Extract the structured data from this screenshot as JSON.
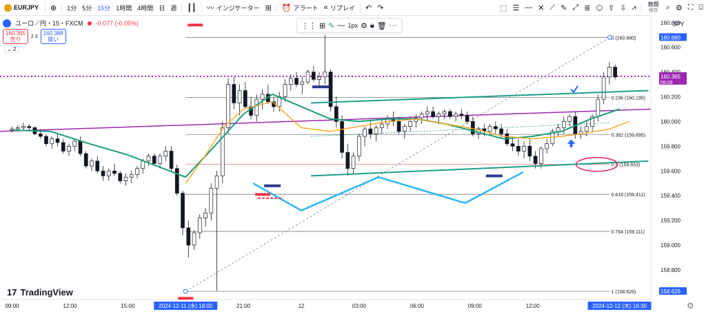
{
  "toolbar": {
    "symbol": "EURJPY",
    "add_icon": "plus-circle-icon",
    "intervals": [
      "1分",
      "5分",
      "15分",
      "1時間",
      "4時間",
      "日",
      "週"
    ],
    "selected_interval": "15分",
    "indicators_label": "インジケーター",
    "alert_label": "アラート",
    "replay_label": "リプレイ",
    "layout_label": "無題",
    "layout_sub": "保存"
  },
  "legend": {
    "title": "ユーロ／円・15・FXCM",
    "change": "-0.077 (-0.05%)"
  },
  "price_buttons": {
    "sell_price": "160.365",
    "sell_label": "売り",
    "spread": "2.3",
    "buy_price": "160.388",
    "buy_label": "買い"
  },
  "indicator_toggle": "2",
  "drawbar": {
    "width_label": "1px"
  },
  "currency": "JPY",
  "watermark": "TradingView",
  "colors": {
    "up": "#ffffff",
    "down": "#131722",
    "ema_teal": "#1b9e77",
    "ema_orange": "#f5a623",
    "channel": "#1e9e8a",
    "purple": "#9c27b0",
    "fib": "#131722",
    "blue_zigzag": "#29b6f6",
    "mark_red": "#f23645",
    "mark_navy": "#2e3b8c",
    "axis_blue": "#2962ff",
    "axis_purple": "#9c27b0"
  },
  "chart_data": {
    "type": "candlestick",
    "title": "",
    "xlabel": "",
    "ylabel": "",
    "ylim": [
      158.56,
      160.86
    ],
    "y_ticks": [
      160.8,
      160.6,
      160.4,
      160.2,
      160.0,
      159.8,
      159.6,
      159.4,
      159.2,
      159.0,
      158.8
    ],
    "x_ticks": [
      {
        "t": 0.0,
        "label": "09:00"
      },
      {
        "t": 12.0,
        "label": "12:00"
      },
      {
        "t": 24.0,
        "label": "15:00"
      },
      {
        "t": 48.0,
        "label": "21:00"
      },
      {
        "t": 60.0,
        "label": "12"
      },
      {
        "t": 72.0,
        "label": "03:00"
      },
      {
        "t": 84.0,
        "label": "06:00"
      },
      {
        "t": 96.0,
        "label": "09:00"
      },
      {
        "t": 108.0,
        "label": "12:00"
      },
      {
        "t": 120.0,
        "label": "15"
      },
      {
        "t": 132.0,
        "label": "00"
      }
    ],
    "x_range": [
      -2.5,
      132.5
    ],
    "time_badges": [
      {
        "t": 36.0,
        "label": "2024-12-11 (水)   18:00"
      },
      {
        "t": 126.0,
        "label": "2024-12-12 (木)   16:30"
      }
    ],
    "price_badges": [
      {
        "value": 160.68,
        "label": "160.680",
        "color": "#2962ff"
      },
      {
        "value": 160.365,
        "label": "160.365",
        "sub": "08:09",
        "color": "#9c27b0"
      },
      {
        "value": 158.626,
        "label": "158.626",
        "color": "#2962ff"
      }
    ],
    "fibonacci": [
      {
        "level": "0",
        "value": 160.68
      },
      {
        "level": "0.236",
        "value": 160.195
      },
      {
        "level": "0.382",
        "value": 159.895
      },
      {
        "level": "0.5",
        "value": 159.653
      },
      {
        "level": "0.618",
        "value": 159.411
      },
      {
        "level": "0.764",
        "value": 159.111
      },
      {
        "level": "1",
        "value": 158.626
      }
    ],
    "fib_time_range": [
      36,
      124
    ],
    "horizontal_line": {
      "value": 160.365
    },
    "ohlc": [
      [
        159.93,
        159.96,
        159.91,
        159.94
      ],
      [
        159.94,
        159.97,
        159.92,
        159.95
      ],
      [
        159.95,
        159.99,
        159.93,
        159.96
      ],
      [
        159.96,
        159.98,
        159.93,
        159.95
      ],
      [
        159.95,
        159.96,
        159.89,
        159.9
      ],
      [
        159.9,
        159.94,
        159.86,
        159.88
      ],
      [
        159.88,
        159.9,
        159.8,
        159.82
      ],
      [
        159.82,
        159.88,
        159.78,
        159.86
      ],
      [
        159.86,
        159.9,
        159.8,
        159.83
      ],
      [
        159.83,
        159.86,
        159.74,
        159.76
      ],
      [
        159.76,
        159.82,
        159.72,
        159.8
      ],
      [
        159.8,
        159.86,
        159.76,
        159.84
      ],
      [
        159.84,
        159.88,
        159.72,
        159.74
      ],
      [
        159.74,
        159.76,
        159.62,
        159.64
      ],
      [
        159.64,
        159.7,
        159.6,
        159.68
      ],
      [
        159.68,
        159.72,
        159.58,
        159.6
      ],
      [
        159.6,
        159.64,
        159.52,
        159.56
      ],
      [
        159.56,
        159.62,
        159.52,
        159.6
      ],
      [
        159.6,
        159.66,
        159.56,
        159.58
      ],
      [
        159.58,
        159.6,
        159.5,
        159.52
      ],
      [
        159.52,
        159.58,
        159.48,
        159.55
      ],
      [
        159.55,
        159.6,
        159.5,
        159.57
      ],
      [
        159.57,
        159.64,
        159.54,
        159.62
      ],
      [
        159.62,
        159.7,
        159.58,
        159.68
      ],
      [
        159.68,
        159.74,
        159.64,
        159.72
      ],
      [
        159.72,
        159.74,
        159.64,
        159.66
      ],
      [
        159.66,
        159.74,
        159.62,
        159.72
      ],
      [
        159.72,
        159.8,
        159.68,
        159.76
      ],
      [
        159.76,
        159.8,
        159.6,
        159.62
      ],
      [
        159.62,
        159.65,
        159.4,
        159.42
      ],
      [
        159.42,
        159.44,
        159.08,
        159.14
      ],
      [
        159.14,
        159.2,
        158.9,
        159.0
      ],
      [
        159.0,
        159.12,
        158.96,
        159.1
      ],
      [
        159.1,
        159.25,
        159.05,
        159.22
      ],
      [
        159.22,
        159.3,
        159.15,
        159.26
      ],
      [
        159.26,
        159.5,
        159.2,
        159.46
      ],
      [
        159.46,
        159.6,
        158.63,
        159.56
      ],
      [
        159.56,
        160.0,
        159.5,
        159.95
      ],
      [
        159.95,
        160.35,
        159.9,
        160.3
      ],
      [
        160.3,
        160.36,
        160.1,
        160.15
      ],
      [
        160.15,
        160.3,
        160.05,
        160.25
      ],
      [
        160.25,
        160.32,
        160.1,
        160.12
      ],
      [
        160.12,
        160.2,
        160.02,
        160.05
      ],
      [
        160.05,
        160.22,
        160.0,
        160.18
      ],
      [
        160.18,
        160.26,
        160.1,
        160.22
      ],
      [
        160.22,
        160.3,
        160.14,
        160.16
      ],
      [
        160.16,
        160.2,
        160.08,
        160.12
      ],
      [
        160.12,
        160.24,
        160.08,
        160.2
      ],
      [
        160.2,
        160.34,
        160.16,
        160.3
      ],
      [
        160.3,
        160.38,
        160.25,
        160.35
      ],
      [
        160.35,
        160.4,
        160.28,
        160.3
      ],
      [
        160.3,
        160.36,
        160.22,
        160.32
      ],
      [
        160.32,
        160.42,
        160.3,
        160.4
      ],
      [
        160.4,
        160.45,
        160.32,
        160.34
      ],
      [
        160.34,
        160.4,
        160.28,
        160.36
      ],
      [
        160.36,
        160.7,
        160.3,
        160.4
      ],
      [
        160.4,
        160.42,
        160.08,
        160.12
      ],
      [
        160.12,
        160.2,
        159.95,
        160.0
      ],
      [
        160.0,
        160.05,
        159.7,
        159.75
      ],
      [
        159.75,
        159.82,
        159.56,
        159.62
      ],
      [
        159.62,
        159.75,
        159.58,
        159.72
      ],
      [
        159.72,
        159.9,
        159.68,
        159.88
      ],
      [
        159.88,
        159.96,
        159.8,
        159.94
      ],
      [
        159.94,
        160.0,
        159.86,
        159.9
      ],
      [
        159.9,
        159.97,
        159.84,
        159.95
      ],
      [
        159.95,
        160.02,
        159.9,
        159.98
      ],
      [
        159.98,
        160.05,
        159.94,
        160.02
      ],
      [
        160.02,
        160.08,
        159.96,
        160.0
      ],
      [
        160.0,
        160.04,
        159.9,
        159.92
      ],
      [
        159.92,
        159.98,
        159.86,
        159.96
      ],
      [
        159.96,
        160.04,
        159.92,
        160.0
      ],
      [
        160.0,
        160.06,
        159.95,
        160.03
      ],
      [
        160.03,
        160.08,
        159.98,
        160.06
      ],
      [
        160.06,
        160.12,
        160.0,
        160.08
      ],
      [
        160.08,
        160.12,
        160.02,
        160.04
      ],
      [
        160.04,
        160.08,
        159.98,
        160.06
      ],
      [
        160.06,
        160.1,
        160.02,
        160.08
      ],
      [
        160.08,
        160.1,
        160.02,
        160.04
      ],
      [
        160.04,
        160.08,
        160.0,
        160.06
      ],
      [
        160.06,
        160.1,
        160.02,
        160.05
      ],
      [
        160.05,
        160.08,
        159.98,
        160.0
      ],
      [
        160.0,
        160.04,
        159.88,
        159.9
      ],
      [
        159.9,
        159.96,
        159.86,
        159.94
      ],
      [
        159.94,
        159.98,
        159.88,
        159.92
      ],
      [
        159.92,
        159.98,
        159.88,
        159.96
      ],
      [
        159.96,
        160.0,
        159.9,
        159.94
      ],
      [
        159.94,
        159.98,
        159.86,
        159.9
      ],
      [
        159.9,
        159.94,
        159.8,
        159.82
      ],
      [
        159.82,
        159.88,
        159.76,
        159.8
      ],
      [
        159.8,
        159.86,
        159.72,
        159.76
      ],
      [
        159.76,
        159.84,
        159.7,
        159.8
      ],
      [
        159.8,
        159.86,
        159.68,
        159.72
      ],
      [
        159.72,
        159.76,
        159.62,
        159.66
      ],
      [
        159.66,
        159.8,
        159.62,
        159.78
      ],
      [
        159.78,
        159.86,
        159.74,
        159.82
      ],
      [
        159.82,
        159.94,
        159.8,
        159.92
      ],
      [
        159.92,
        159.98,
        159.88,
        159.95
      ],
      [
        159.95,
        160.04,
        159.9,
        160.0
      ],
      [
        160.0,
        160.06,
        159.96,
        160.04
      ],
      [
        160.04,
        160.08,
        159.86,
        159.9
      ],
      [
        159.9,
        159.96,
        159.86,
        159.92
      ],
      [
        159.92,
        160.0,
        159.88,
        159.96
      ],
      [
        159.96,
        160.06,
        159.92,
        160.04
      ],
      [
        160.04,
        160.22,
        160.0,
        160.18
      ],
      [
        160.18,
        160.4,
        160.14,
        160.36
      ],
      [
        160.36,
        160.48,
        160.3,
        160.44
      ],
      [
        160.44,
        160.46,
        160.34,
        160.36
      ]
    ],
    "ohlc_start_t": 0,
    "ohlc_step_t": 1.18,
    "series": [
      {
        "name": "",
        "color": "#1b9e77",
        "points": [
          [
            0,
            159.93
          ],
          [
            8,
            159.92
          ],
          [
            16,
            159.82
          ],
          [
            24,
            159.73
          ],
          [
            30,
            159.64
          ],
          [
            36,
            159.55
          ],
          [
            42,
            159.8
          ],
          [
            48,
            160.06
          ],
          [
            54,
            160.22
          ],
          [
            60,
            160.12
          ],
          [
            66,
            160.02
          ],
          [
            72,
            160.0
          ],
          [
            78,
            160.02
          ],
          [
            84,
            160.02
          ],
          [
            90,
            159.98
          ],
          [
            96,
            159.92
          ],
          [
            102,
            159.86
          ],
          [
            108,
            159.88
          ],
          [
            114,
            159.92
          ],
          [
            120,
            160.02
          ],
          [
            126,
            160.1
          ]
        ]
      },
      {
        "name": "",
        "color": "#f5a623",
        "points": [
          [
            36,
            159.5
          ],
          [
            40,
            159.72
          ],
          [
            44,
            159.96
          ],
          [
            48,
            160.1
          ],
          [
            54,
            160.16
          ],
          [
            60,
            159.95
          ],
          [
            66,
            159.92
          ],
          [
            72,
            159.96
          ],
          [
            78,
            160.0
          ],
          [
            84,
            160.02
          ],
          [
            90,
            159.98
          ],
          [
            96,
            159.94
          ],
          [
            102,
            159.88
          ],
          [
            108,
            159.86
          ],
          [
            114,
            159.88
          ],
          [
            118,
            159.9
          ],
          [
            124,
            159.94
          ],
          [
            128,
            160.0
          ]
        ]
      }
    ],
    "channel_lines": [
      {
        "from": [
          62,
          160.15
        ],
        "to": [
          132,
          160.25
        ]
      },
      {
        "from": [
          62,
          159.56
        ],
        "to": [
          132,
          159.68
        ]
      }
    ],
    "purple_line": {
      "from": [
        -2.5,
        159.92
      ],
      "to": [
        132.5,
        160.1
      ]
    },
    "zigzag": [
      [
        50,
        159.5
      ],
      [
        60,
        159.28
      ],
      [
        76,
        159.55
      ],
      [
        94,
        159.34
      ],
      [
        106,
        159.59
      ]
    ],
    "diagonal": {
      "from": [
        36,
        158.626
      ],
      "to": [
        124,
        160.68
      ]
    },
    "circle_annotation": {
      "t": 117,
      "value": 159.653
    },
    "check_mark": {
      "t": 116.5,
      "value": 160.26
    },
    "arrow_up": {
      "t": 116,
      "value": 159.82
    },
    "markers_red": [
      [
        38,
        160.78
      ],
      [
        36,
        158.57
      ],
      [
        52,
        159.41
      ]
    ],
    "markers_navy": [
      [
        64,
        160.28
      ],
      [
        54,
        159.48
      ],
      [
        100,
        159.56
      ]
    ],
    "dashed_red_segment": {
      "from": [
        51,
        159.38
      ],
      "to": [
        56,
        159.38
      ]
    },
    "dashed_green": {
      "from": [
        62,
        159.88
      ],
      "to": [
        124,
        159.99
      ]
    }
  }
}
